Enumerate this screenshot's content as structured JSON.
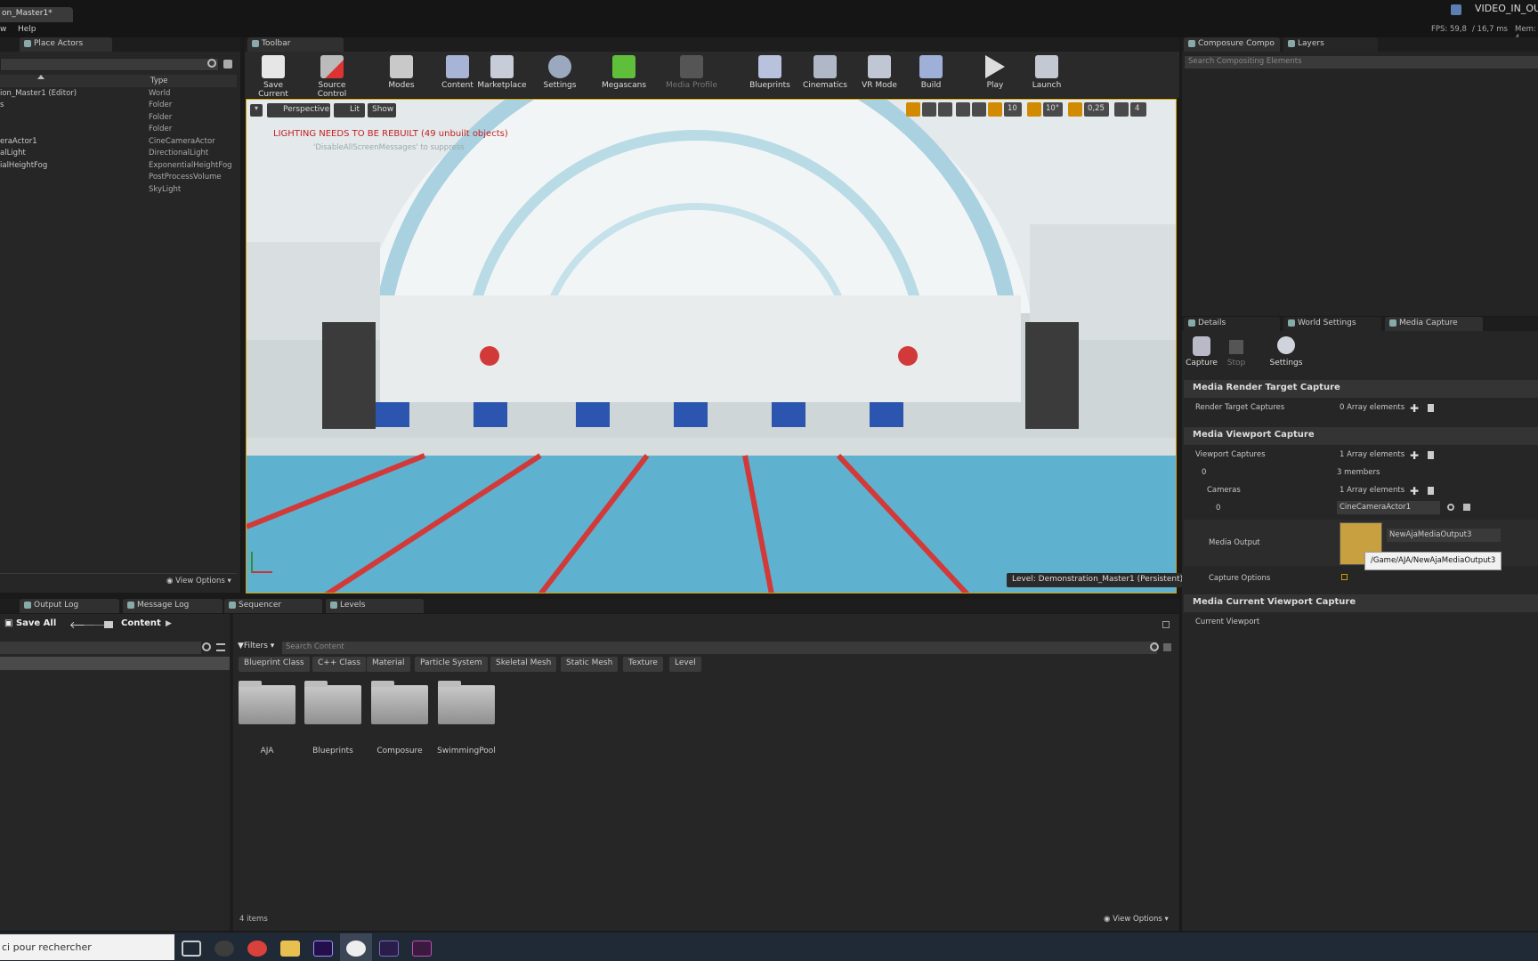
{
  "window": {
    "doc_tab": "on_Master1*",
    "right_title": "VIDEO_IN_OU"
  },
  "menu": {
    "items": [
      "w",
      "Help"
    ],
    "stats": {
      "fps": "FPS: 59,8",
      "ms": "/ 16,7 ms",
      "mem": "Mem: 4."
    }
  },
  "outliner": {
    "tab": "Place Actors",
    "type_header": "Type",
    "view_options": "View Options",
    "rows": [
      {
        "name": "ion_Master1 (Editor)",
        "type": "World"
      },
      {
        "name": "s",
        "type": "Folder"
      },
      {
        "name": "",
        "type": "Folder"
      },
      {
        "name": "",
        "type": "Folder"
      },
      {
        "name": "eraActor1",
        "type": "CineCameraActor"
      },
      {
        "name": "alLight",
        "type": "DirectionalLight"
      },
      {
        "name": "ialHeightFog",
        "type": "ExponentialHeightFog"
      },
      {
        "name": "",
        "type": "PostProcessVolume"
      },
      {
        "name": "",
        "type": "SkyLight"
      }
    ]
  },
  "toolbar": {
    "tab": "Toolbar",
    "buttons": [
      "Save Current",
      "Source Control",
      "Modes",
      "Content",
      "Marketplace",
      "Settings",
      "Megascans",
      "Media Profile",
      "Blueprints",
      "Cinematics",
      "VR Mode",
      "Build",
      "Play",
      "Launch"
    ]
  },
  "viewport": {
    "perspective": "Perspective",
    "lit": "Lit",
    "show": "Show",
    "warning": "LIGHTING NEEDS TO BE REBUILT (49 unbuilt objects)",
    "suppress": "'DisableAllScreenMessages' to suppress",
    "grid": "10",
    "angle": "10°",
    "scale": "0,25",
    "speed": "4",
    "level": "Level:  Demonstration_Master1 (Persistent)"
  },
  "composure": {
    "tabs": [
      "Composure Compo",
      "Layers"
    ],
    "search_placeholder": "Search Compositing Elements"
  },
  "details": {
    "tabs": [
      "Details",
      "World Settings",
      "Media Capture"
    ],
    "buttons": [
      "Capture",
      "Stop",
      "Settings"
    ],
    "sections": {
      "render_target": "Media Render Target Capture",
      "viewport": "Media Viewport Capture",
      "current": "Media Current Viewport Capture"
    },
    "render_target_captures": "Render Target Captures",
    "rt_value": "0 Array elements",
    "viewport_captures": "Viewport Captures",
    "vc_value": "1 Array elements",
    "index0": "0",
    "members": "3 members",
    "cameras": "Cameras",
    "cameras_value": "1 Array elements",
    "cam_index": "0",
    "cam_value": "CineCameraActor1",
    "media_output": "Media Output",
    "media_output_value": "NewAjaMediaOutput3",
    "tooltip": "/Game/AJA/NewAjaMediaOutput3",
    "capture_options": "Capture Options",
    "current_viewport": "Current Viewport"
  },
  "bottom_tabs": [
    "Output Log",
    "Message Log",
    "Sequencer",
    "Levels"
  ],
  "content_browser": {
    "save_all": "Save All",
    "path": "Content",
    "filters": "Filters",
    "search_placeholder": "Search Content",
    "chips": [
      "Blueprint Class",
      "C++ Class",
      "Material",
      "Particle System",
      "Skeletal Mesh",
      "Static Mesh",
      "Texture",
      "Level"
    ],
    "folders": [
      "AJA",
      "Blueprints",
      "Composure",
      "SwimmingPool"
    ],
    "count": "4 items",
    "view_options": "View Options"
  },
  "taskbar": {
    "search": "ci pour rechercher",
    "apps": [
      "task-view",
      "obs",
      "chrome",
      "explorer",
      "premiere",
      "unreal",
      "ndi",
      "ndi-2"
    ]
  }
}
